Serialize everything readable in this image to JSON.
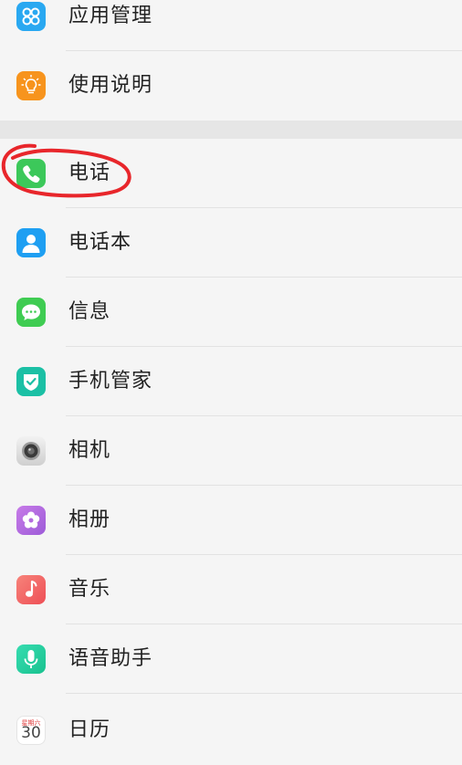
{
  "items": [
    {
      "label": "应用管理",
      "icon": "app-management-icon",
      "color": "#29a8f1"
    },
    {
      "label": "使用说明",
      "icon": "lightbulb-icon",
      "color": "#f7941d"
    },
    {
      "label": "电话",
      "icon": "phone-icon",
      "color": "#3cc85a"
    },
    {
      "label": "电话本",
      "icon": "contacts-icon",
      "color": "#1e9ff2"
    },
    {
      "label": "信息",
      "icon": "message-icon",
      "color": "#3fcc52"
    },
    {
      "label": "手机管家",
      "icon": "shield-check-icon",
      "color": "#1bc0a5"
    },
    {
      "label": "相机",
      "icon": "camera-icon",
      "color": "#bfbfbf"
    },
    {
      "label": "相册",
      "icon": "flower-icon",
      "color": "#b46ae0"
    },
    {
      "label": "音乐",
      "icon": "music-note-icon",
      "color": "#f25a5a"
    },
    {
      "label": "语音助手",
      "icon": "microphone-icon",
      "color": "#2bd6a3"
    },
    {
      "label": "日历",
      "icon": "calendar-icon",
      "color": "#ffffff"
    }
  ],
  "calendar": {
    "weekday": "星期六",
    "day": "30"
  },
  "annotation_color": "#e8262b"
}
